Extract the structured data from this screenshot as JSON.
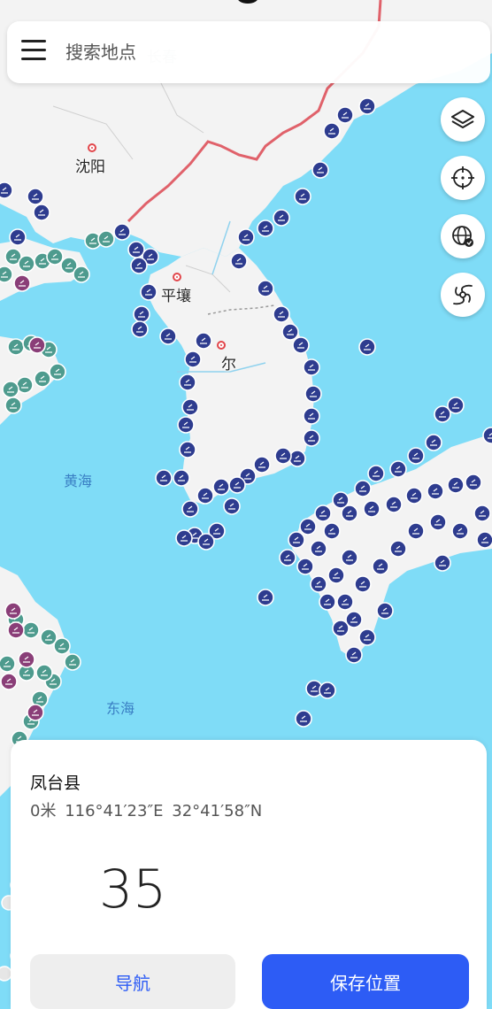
{
  "search": {
    "placeholder": "搜索地点"
  },
  "map": {
    "cities": [
      {
        "name": "沈阳"
      },
      {
        "name": "平壤"
      },
      {
        "name": "首尔",
        "display": "尔"
      },
      {
        "name": "长春",
        "display": "长春"
      }
    ],
    "seas": [
      {
        "name": "黄海"
      },
      {
        "name": "东海"
      }
    ],
    "colors": {
      "water": "#7fdcf7",
      "land": "#f2f2f2",
      "border": "#e0616a",
      "marker_navy": "#2e3c8f",
      "marker_teal": "#4e9b8e",
      "marker_purple": "#8a3e78",
      "accent": "#2d5cf5"
    }
  },
  "controls": [
    {
      "icon": "layers-icon"
    },
    {
      "icon": "crosshair-icon"
    },
    {
      "icon": "globe-icon"
    },
    {
      "icon": "typhoon-icon"
    }
  ],
  "panel": {
    "place_name": "凤台县",
    "elevation": "0米",
    "longitude": "116°41′23″E",
    "latitude": "32°41′58″N",
    "big_number": "35",
    "nav_label": "导航",
    "save_label": "保存位置"
  }
}
